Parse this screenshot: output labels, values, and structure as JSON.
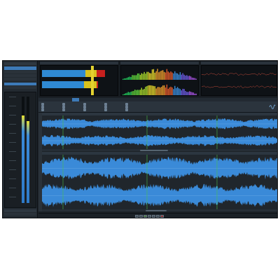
{
  "left_panel": {
    "title": "",
    "selected_item": "",
    "rows": [
      "",
      "",
      "",
      "",
      ""
    ],
    "meter_levels": [
      0.82,
      0.77
    ]
  },
  "top_panels": {
    "level_meter_header": "",
    "spectrum_header": "",
    "phase_header": "",
    "level_meter_values": [
      0.62,
      0.58
    ]
  },
  "editor": {
    "tabs": [
      "",
      "",
      "",
      "",
      ""
    ],
    "active_tab_index": 4,
    "ribbon_groups": [
      {
        "items": [
          "",
          "",
          ""
        ]
      },
      {
        "items": [
          "",
          "",
          ""
        ]
      },
      {
        "items": [
          "",
          "",
          ""
        ]
      },
      {
        "items": [
          "",
          "",
          ""
        ]
      },
      {
        "items": [
          "",
          "",
          ""
        ]
      }
    ]
  },
  "transport": {
    "time_display": ""
  },
  "colors": {
    "app_background": "#1c2228",
    "waveform": "#3a8ad8",
    "waveform_light": "#62b0ef",
    "selection_blue": "#3d7ab8",
    "marker_green": "#4ac24a"
  },
  "icons": {
    "logo": "wavelab-logo-icon",
    "play": "play-icon",
    "stop": "stop-icon",
    "record": "record-icon"
  }
}
